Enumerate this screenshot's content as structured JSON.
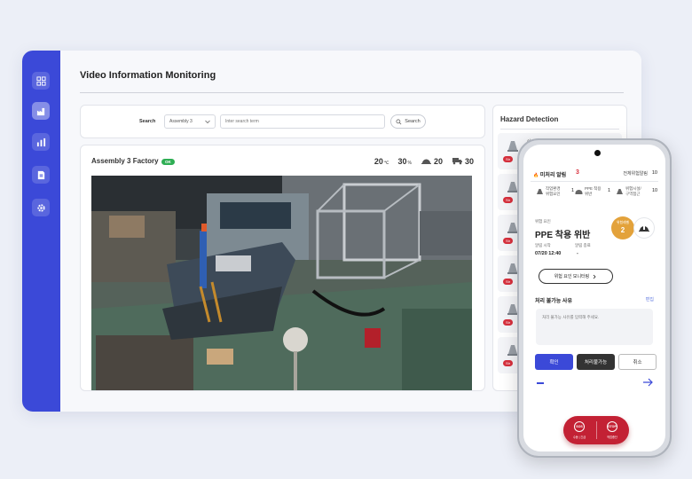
{
  "app": {
    "page_title": "Video Information Monitoring"
  },
  "search": {
    "label": "Search",
    "select_value": "Assembly 3",
    "placeholder": "Inter search term",
    "button_label": "Search"
  },
  "camera": {
    "name": "Assembly 3 Factory",
    "status": "OK",
    "temperature": "20",
    "temperature_unit": "℃",
    "humidity": "30",
    "humidity_unit": "%",
    "helmet_count": "20",
    "vehicle_count": "30"
  },
  "hazard": {
    "title": "Hazard Detection",
    "first_alarm": {
      "label": "Alarm No",
      "value": "345124",
      "tag": "Str"
    },
    "tag_short": "Str"
  },
  "mobile": {
    "title": "미처리 알림",
    "count": "3",
    "total_label": "전체위험알림",
    "total_value": "10",
    "categories": [
      {
        "label_line1": "작업환경",
        "label_line2": "위험요인",
        "count": "1"
      },
      {
        "label_line1": "PPE 착용",
        "label_line2": "위반",
        "count": "1"
      },
      {
        "label_line1": "위험시설/",
        "label_line2": "구역접근",
        "count": "10"
      }
    ],
    "hazard_factor_label": "위험 요인",
    "hazard_factor_value": "PPE 착용 위반",
    "level_label": "위험레벨",
    "level_value": "2",
    "start_label": "알림 시작",
    "start_value": "07/20 12:40",
    "end_label": "알림 종료",
    "end_value": "-",
    "monitor_button": "위험 요인 모니터링",
    "reason_title": "처리 불가능 사유",
    "reason_edit": "편집",
    "reason_placeholder": "처리 불가능 사유를 입력해 주세요.",
    "confirm_button": "확인",
    "unable_button": "처리불가능",
    "cancel_button": "취소",
    "sos_icon": "SOS",
    "sos_label": "수동 | 긴급",
    "stop_icon": "STOP",
    "stop_label": "작업중단"
  }
}
